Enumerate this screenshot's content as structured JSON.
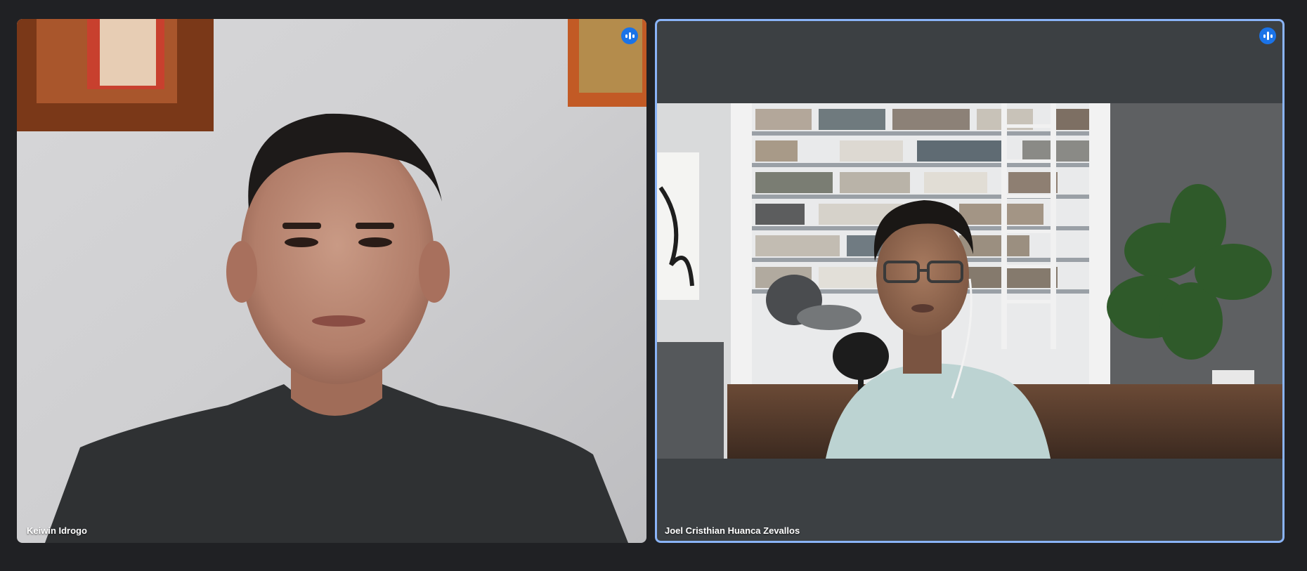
{
  "participants": [
    {
      "name": "Keiwin Idrogo",
      "indicator_icon": "audio-level-icon",
      "active_speaker": false
    },
    {
      "name": "Joel Cristhian Huanca Zevallos",
      "indicator_icon": "audio-level-icon",
      "active_speaker": true
    }
  ],
  "colors": {
    "background": "#202124",
    "tile_background": "#3c4043",
    "active_border": "#8ab4f8",
    "indicator_bg": "#1a73e8"
  }
}
